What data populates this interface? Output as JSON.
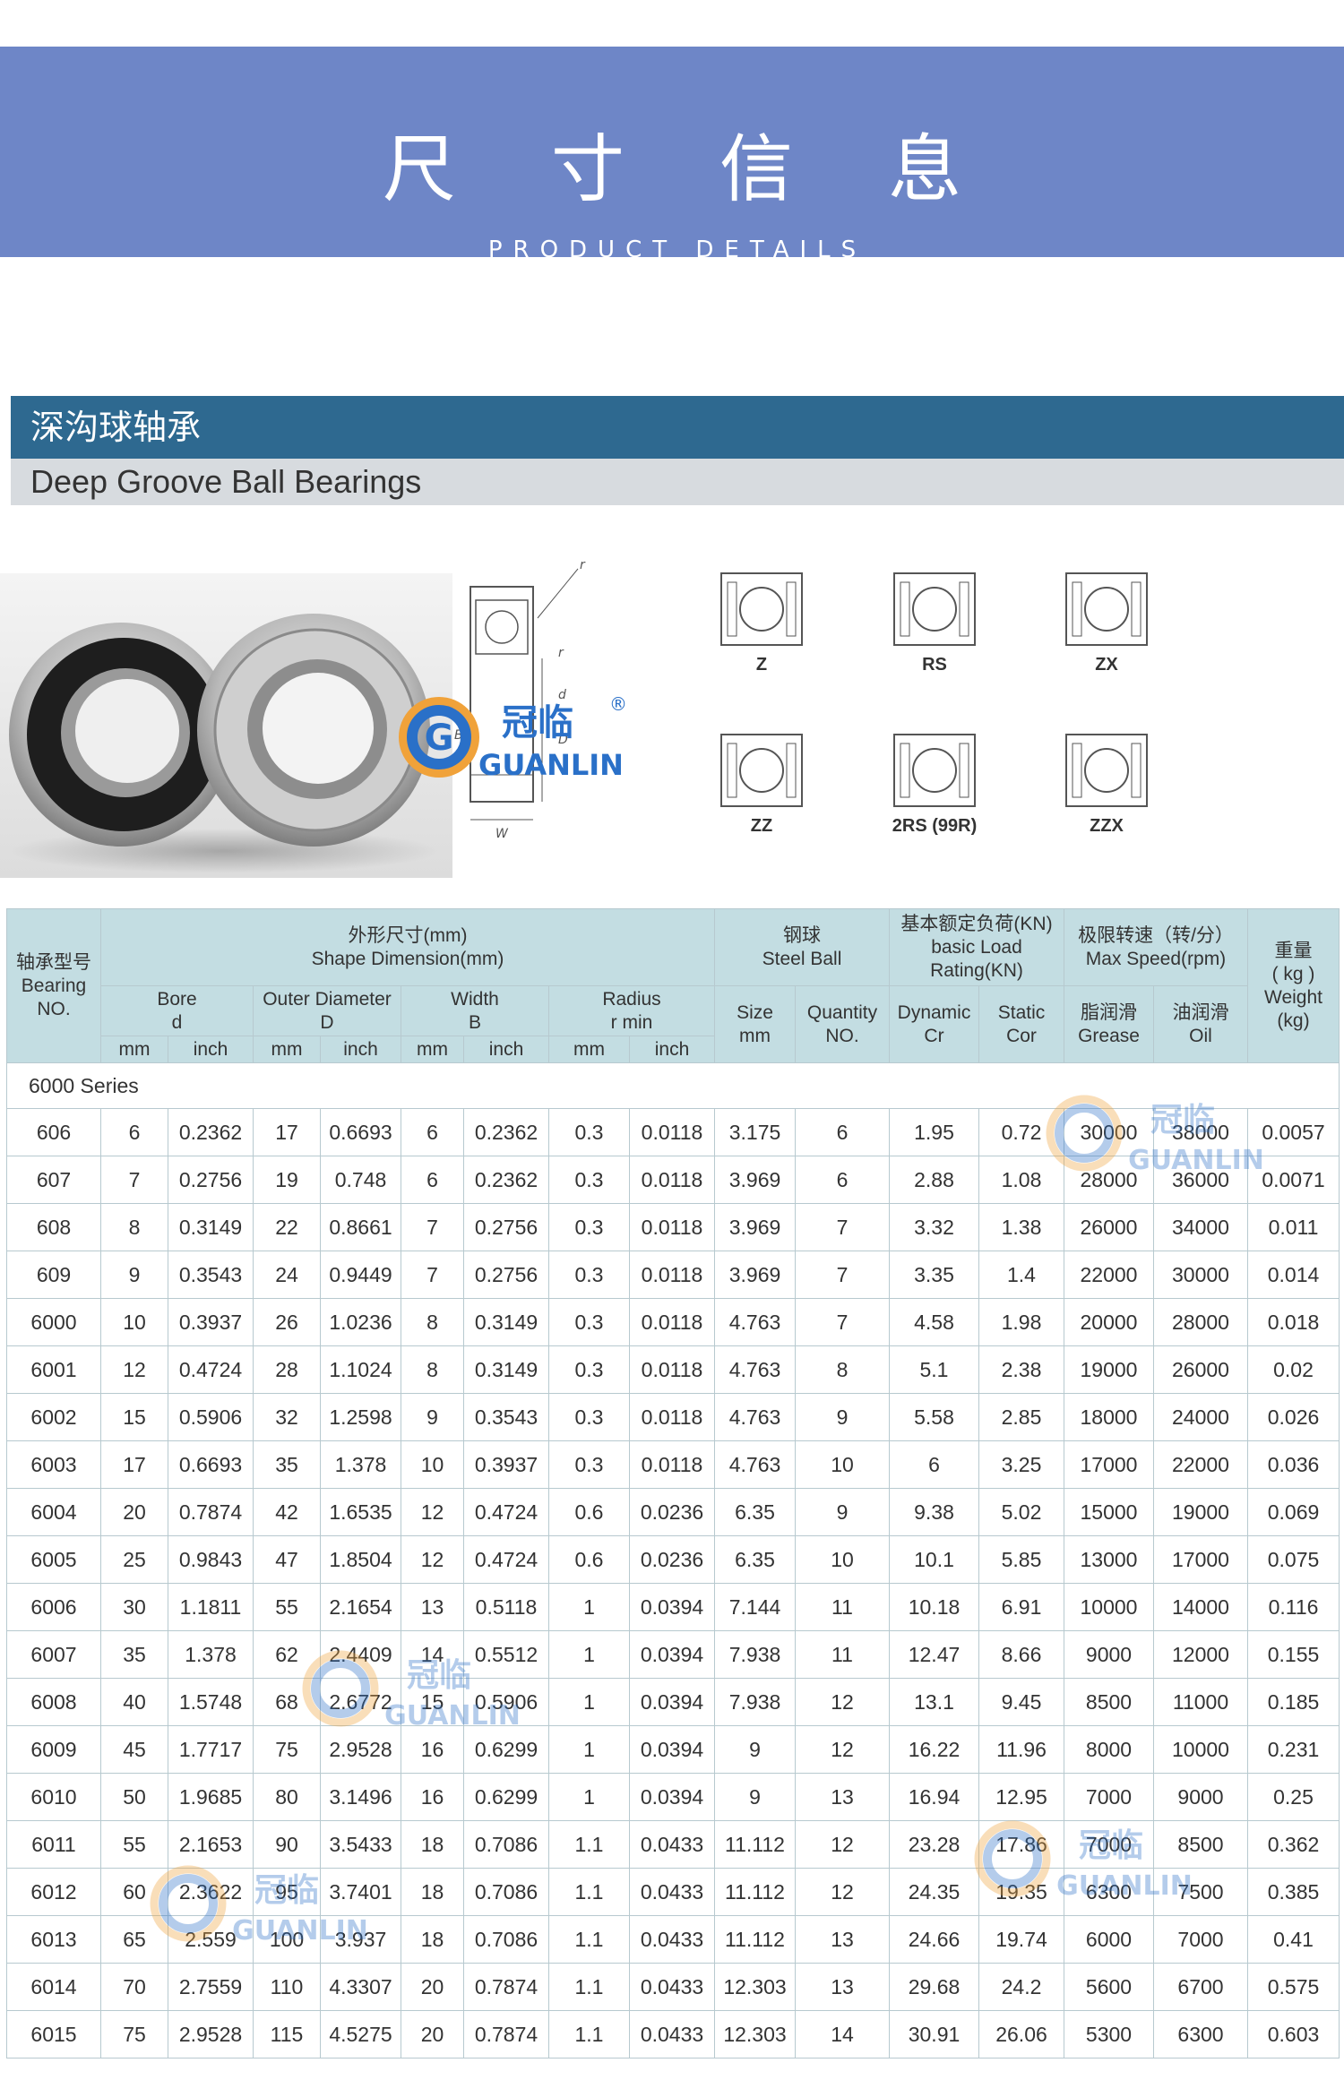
{
  "banner": {
    "title": "尺 寸 信 息",
    "subtitle": "PRODUCT  DETAILS"
  },
  "section": {
    "title_cn": "深沟球轴承",
    "title_en": "Deep Groove Ball Bearings"
  },
  "logo": {
    "cn": "冠临",
    "en": "GUANLIN",
    "mark": "®",
    "letter": "G"
  },
  "diagram": {
    "labels": {
      "r": "r",
      "d": "d",
      "D": "D",
      "B": "B",
      "W": "W"
    }
  },
  "types": [
    {
      "label": "Z"
    },
    {
      "label": "RS"
    },
    {
      "label": "ZX"
    },
    {
      "label": "ZZ"
    },
    {
      "label": "2RS (99R)"
    },
    {
      "label": "ZZX"
    }
  ],
  "table": {
    "headers": {
      "bearing_no_cn": "轴承型号",
      "bearing_no_en": "Bearing NO.",
      "shape_cn": "外形尺寸(mm)",
      "shape_en": "Shape Dimension(mm)",
      "ball_cn": "钢球",
      "ball_en": "Steel Ball",
      "load_cn": "基本额定负荷(KN)",
      "load_en": "basic Load Rating(KN)",
      "speed_cn": "极限转速（转/分）",
      "speed_en": "Max Speed(rpm)",
      "weight_cn": "重量",
      "weight_unit": "( kg )",
      "weight_en": "Weight (kg)",
      "bore": "Bore",
      "bore_sym": "d",
      "outer": "Outer Diameter",
      "outer_sym": "D",
      "width": "Width",
      "width_sym": "B",
      "radius": "Radius",
      "radius_sym": "r min",
      "size": "Size",
      "size_unit": "mm",
      "quantity": "Quantity",
      "quantity_unit": "NO.",
      "dynamic": "Dynamic",
      "dynamic_sym": "Cr",
      "static": "Static",
      "static_sym": "Cor",
      "grease_cn": "脂润滑",
      "grease_en": "Grease",
      "oil_cn": "油润滑",
      "oil_en": "Oil",
      "mm": "mm",
      "inch": "inch"
    },
    "series_label": "6000  Series",
    "rows": [
      [
        "606",
        "6",
        "0.2362",
        "17",
        "0.6693",
        "6",
        "0.2362",
        "0.3",
        "0.0118",
        "3.175",
        "6",
        "1.95",
        "0.72",
        "30000",
        "38000",
        "0.0057"
      ],
      [
        "607",
        "7",
        "0.2756",
        "19",
        "0.748",
        "6",
        "0.2362",
        "0.3",
        "0.0118",
        "3.969",
        "6",
        "2.88",
        "1.08",
        "28000",
        "36000",
        "0.0071"
      ],
      [
        "608",
        "8",
        "0.3149",
        "22",
        "0.8661",
        "7",
        "0.2756",
        "0.3",
        "0.0118",
        "3.969",
        "7",
        "3.32",
        "1.38",
        "26000",
        "34000",
        "0.011"
      ],
      [
        "609",
        "9",
        "0.3543",
        "24",
        "0.9449",
        "7",
        "0.2756",
        "0.3",
        "0.0118",
        "3.969",
        "7",
        "3.35",
        "1.4",
        "22000",
        "30000",
        "0.014"
      ],
      [
        "6000",
        "10",
        "0.3937",
        "26",
        "1.0236",
        "8",
        "0.3149",
        "0.3",
        "0.0118",
        "4.763",
        "7",
        "4.58",
        "1.98",
        "20000",
        "28000",
        "0.018"
      ],
      [
        "6001",
        "12",
        "0.4724",
        "28",
        "1.1024",
        "8",
        "0.3149",
        "0.3",
        "0.0118",
        "4.763",
        "8",
        "5.1",
        "2.38",
        "19000",
        "26000",
        "0.02"
      ],
      [
        "6002",
        "15",
        "0.5906",
        "32",
        "1.2598",
        "9",
        "0.3543",
        "0.3",
        "0.0118",
        "4.763",
        "9",
        "5.58",
        "2.85",
        "18000",
        "24000",
        "0.026"
      ],
      [
        "6003",
        "17",
        "0.6693",
        "35",
        "1.378",
        "10",
        "0.3937",
        "0.3",
        "0.0118",
        "4.763",
        "10",
        "6",
        "3.25",
        "17000",
        "22000",
        "0.036"
      ],
      [
        "6004",
        "20",
        "0.7874",
        "42",
        "1.6535",
        "12",
        "0.4724",
        "0.6",
        "0.0236",
        "6.35",
        "9",
        "9.38",
        "5.02",
        "15000",
        "19000",
        "0.069"
      ],
      [
        "6005",
        "25",
        "0.9843",
        "47",
        "1.8504",
        "12",
        "0.4724",
        "0.6",
        "0.0236",
        "6.35",
        "10",
        "10.1",
        "5.85",
        "13000",
        "17000",
        "0.075"
      ],
      [
        "6006",
        "30",
        "1.1811",
        "55",
        "2.1654",
        "13",
        "0.5118",
        "1",
        "0.0394",
        "7.144",
        "11",
        "10.18",
        "6.91",
        "10000",
        "14000",
        "0.116"
      ],
      [
        "6007",
        "35",
        "1.378",
        "62",
        "2.4409",
        "14",
        "0.5512",
        "1",
        "0.0394",
        "7.938",
        "11",
        "12.47",
        "8.66",
        "9000",
        "12000",
        "0.155"
      ],
      [
        "6008",
        "40",
        "1.5748",
        "68",
        "2.6772",
        "15",
        "0.5906",
        "1",
        "0.0394",
        "7.938",
        "12",
        "13.1",
        "9.45",
        "8500",
        "11000",
        "0.185"
      ],
      [
        "6009",
        "45",
        "1.7717",
        "75",
        "2.9528",
        "16",
        "0.6299",
        "1",
        "0.0394",
        "9",
        "12",
        "16.22",
        "11.96",
        "8000",
        "10000",
        "0.231"
      ],
      [
        "6010",
        "50",
        "1.9685",
        "80",
        "3.1496",
        "16",
        "0.6299",
        "1",
        "0.0394",
        "9",
        "13",
        "16.94",
        "12.95",
        "7000",
        "9000",
        "0.25"
      ],
      [
        "6011",
        "55",
        "2.1653",
        "90",
        "3.5433",
        "18",
        "0.7086",
        "1.1",
        "0.0433",
        "11.112",
        "12",
        "23.28",
        "17.86",
        "7000",
        "8500",
        "0.362"
      ],
      [
        "6012",
        "60",
        "2.3622",
        "95",
        "3.7401",
        "18",
        "0.7086",
        "1.1",
        "0.0433",
        "11.112",
        "12",
        "24.35",
        "19.35",
        "6300",
        "7500",
        "0.385"
      ],
      [
        "6013",
        "65",
        "2.559",
        "100",
        "3.937",
        "18",
        "0.7086",
        "1.1",
        "0.0433",
        "11.112",
        "13",
        "24.66",
        "19.74",
        "6000",
        "7000",
        "0.41"
      ],
      [
        "6014",
        "70",
        "2.7559",
        "110",
        "4.3307",
        "20",
        "0.7874",
        "1.1",
        "0.0433",
        "12.303",
        "13",
        "29.68",
        "24.2",
        "5600",
        "6700",
        "0.575"
      ],
      [
        "6015",
        "75",
        "2.9528",
        "115",
        "4.5275",
        "20",
        "0.7874",
        "1.1",
        "0.0433",
        "12.303",
        "14",
        "30.91",
        "26.06",
        "5300",
        "6300",
        "0.603"
      ]
    ]
  }
}
